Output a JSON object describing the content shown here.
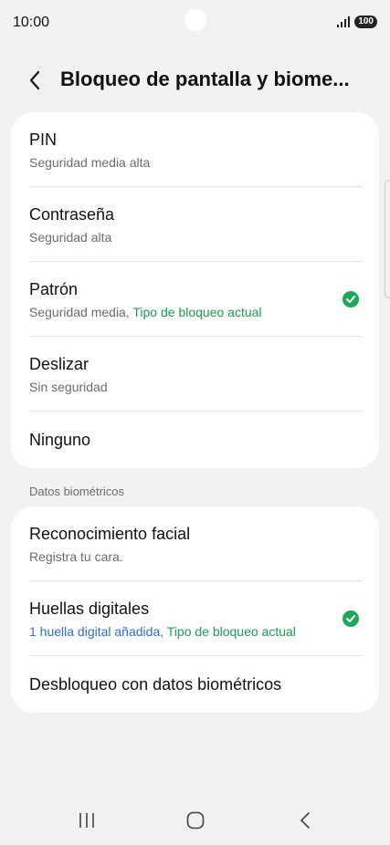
{
  "status": {
    "time": "10:00",
    "battery": "100"
  },
  "header": {
    "title": "Bloqueo de pantalla y biome..."
  },
  "lock_types": [
    {
      "title": "PIN",
      "subtitle": "Seguridad media alta"
    },
    {
      "title": "Contraseña",
      "subtitle": "Seguridad alta"
    },
    {
      "title": "Patrón",
      "subtitle": "Seguridad media, ",
      "subtitle_highlight": "Tipo de bloqueo actual",
      "selected": true
    },
    {
      "title": "Deslizar",
      "subtitle": "Sin seguridad"
    },
    {
      "title": "Ninguno"
    }
  ],
  "biometrics": {
    "section_label": "Datos biométricos",
    "items": [
      {
        "title": "Reconocimiento facial",
        "subtitle": "Registra tu cara."
      },
      {
        "title": "Huellas digitales",
        "subtitle": "1 huella digital añadida, ",
        "subtitle_highlight": "Tipo de bloqueo actual",
        "selected": true
      },
      {
        "title": "Desbloqueo con datos biométricos"
      }
    ]
  },
  "colors": {
    "accent_green": "#1a9a52",
    "link_blue": "#2e6ec9",
    "background": "#f2f2f4",
    "card": "#ffffff"
  }
}
